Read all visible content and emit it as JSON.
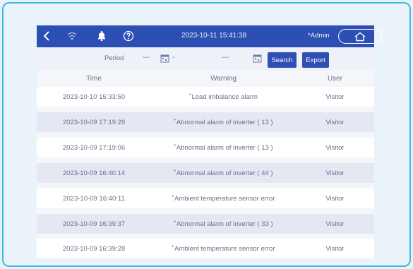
{
  "header": {
    "datetime": "2023-10-11 15:41:38",
    "user": "*Admin",
    "icons": [
      "back-icon",
      "wifi-icon",
      "bell-icon",
      "help-icon",
      "home-icon"
    ]
  },
  "filter": {
    "period_label": "Period",
    "start_date": "---",
    "separator": "-",
    "end_date": "---",
    "search_label": "Search",
    "export_label": "Export"
  },
  "table": {
    "columns": [
      "Time",
      "Warning",
      "User"
    ],
    "rows": [
      {
        "time": "2023-10-10 15:33:50",
        "warning": "Load imbalance alarm",
        "user": "Visitor"
      },
      {
        "time": "2023-10-09 17:19:28",
        "warning": "Abnormal alarm of inverter ( 13 )",
        "user": "Visitor"
      },
      {
        "time": "2023-10-09 17:19:06",
        "warning": "Abnormal alarm of inverter ( 13 )",
        "user": "Visitor"
      },
      {
        "time": "2023-10-09 16:40:14",
        "warning": "Abnormal alarm of inverter ( 44 )",
        "user": "Visitor"
      },
      {
        "time": "2023-10-09 16:40:11",
        "warning": "Ambient temperature sensor error",
        "user": "Visitor"
      },
      {
        "time": "2023-10-09 16:39:37",
        "warning": "Abnormal alarm of inverter ( 33 )",
        "user": "Visitor"
      },
      {
        "time": "2023-10-09 16:39:28",
        "warning": "Ambient temperature sensor error",
        "user": "Visitor"
      }
    ]
  },
  "colors": {
    "header_bg": "#2d4fb4",
    "button_bg": "#2f4fb3",
    "frame_border": "#3fb6e6",
    "alarm_mark": "#e04848"
  }
}
